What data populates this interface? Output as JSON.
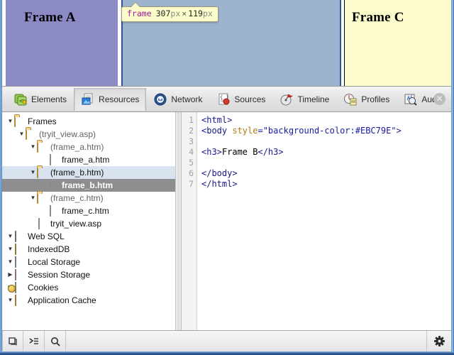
{
  "page": {
    "frames": [
      {
        "name": "frame-a",
        "heading": "Frame A",
        "bg": "#8b8ac4"
      },
      {
        "name": "frame-b",
        "heading": "",
        "bg": "#9db4ce"
      },
      {
        "name": "frame-c",
        "heading": "Frame C",
        "bg": "#fbfbcc"
      }
    ]
  },
  "tooltip": {
    "element": "frame",
    "width": "307",
    "height": "119",
    "unit": "px",
    "separator": "×"
  },
  "devtools": {
    "tabs": [
      {
        "id": "elements",
        "label": "Elements",
        "icon": "elements-icon",
        "selected": false
      },
      {
        "id": "resources",
        "label": "Resources",
        "icon": "resources-icon",
        "selected": true
      },
      {
        "id": "network",
        "label": "Network",
        "icon": "network-icon",
        "selected": false
      },
      {
        "id": "sources",
        "label": "Sources",
        "icon": "sources-icon",
        "selected": false
      },
      {
        "id": "timeline",
        "label": "Timeline",
        "icon": "timeline-icon",
        "selected": false
      },
      {
        "id": "profiles",
        "label": "Profiles",
        "icon": "profiles-icon",
        "selected": false
      },
      {
        "id": "audits",
        "label": "Audits",
        "icon": "audits-icon",
        "selected": false
      }
    ],
    "more_tabs_label": "»",
    "close_label": "✕",
    "statusbar": {
      "dock_icon": "dock-to-side-icon",
      "console_icon": "show-console-icon",
      "search_icon": "search-icon",
      "settings_icon": "gear-icon"
    }
  },
  "resources_tree": [
    {
      "id": "frames",
      "label": "Frames",
      "indent": 0,
      "twisty": "▼",
      "icon": "folder-icon",
      "state": "normal"
    },
    {
      "id": "tryit-view",
      "label": "(tryit_view.asp)",
      "indent": 1,
      "twisty": "▼",
      "icon": "folder-icon",
      "state": "dim"
    },
    {
      "id": "frame-a-dir",
      "label": "(frame_a.htm)",
      "indent": 2,
      "twisty": "▼",
      "icon": "folder-icon",
      "state": "dim"
    },
    {
      "id": "frame-a-file",
      "label": "frame_a.htm",
      "indent": 3,
      "twisty": "",
      "icon": "document-icon",
      "state": "normal"
    },
    {
      "id": "frame-b-dir",
      "label": "(frame_b.htm)",
      "indent": 2,
      "twisty": "▼",
      "icon": "folder-icon",
      "state": "hovered"
    },
    {
      "id": "frame-b-file",
      "label": "frame_b.htm",
      "indent": 3,
      "twisty": "",
      "icon": "document-icon",
      "state": "selected"
    },
    {
      "id": "frame-c-dir",
      "label": "(frame_c.htm)",
      "indent": 2,
      "twisty": "▼",
      "icon": "folder-icon",
      "state": "dim"
    },
    {
      "id": "frame-c-file",
      "label": "frame_c.htm",
      "indent": 3,
      "twisty": "",
      "icon": "document-icon",
      "state": "normal"
    },
    {
      "id": "tryit-file",
      "label": "tryit_view.asp",
      "indent": 2,
      "twisty": "",
      "icon": "document-icon",
      "state": "normal"
    },
    {
      "id": "web-sql",
      "label": "Web SQL",
      "indent": 0,
      "twisty": "▼",
      "icon": "database-icon",
      "state": "normal"
    },
    {
      "id": "indexeddb",
      "label": "IndexedDB",
      "indent": 0,
      "twisty": "▼",
      "icon": "database-yellow-icon",
      "state": "normal"
    },
    {
      "id": "local-storage",
      "label": "Local Storage",
      "indent": 0,
      "twisty": "▼",
      "icon": "grid-blue-icon",
      "state": "normal"
    },
    {
      "id": "session-storage",
      "label": "Session Storage",
      "indent": 0,
      "twisty": "▶",
      "icon": "grid-pink-icon",
      "state": "normal"
    },
    {
      "id": "cookies",
      "label": "Cookies",
      "indent": 0,
      "twisty": "▶",
      "icon": "cookie-icon",
      "state": "normal"
    },
    {
      "id": "app-cache",
      "label": "Application Cache",
      "indent": 0,
      "twisty": "▼",
      "icon": "grid-orange-icon",
      "state": "normal"
    }
  ],
  "source_view": {
    "file": "frame_b.htm",
    "line_numbers": [
      "1",
      "2",
      "3",
      "4",
      "5",
      "6",
      "7"
    ],
    "lines": [
      [
        {
          "t": "tag",
          "s": "<html>"
        }
      ],
      [
        {
          "t": "tag",
          "s": "<body "
        },
        {
          "t": "attr",
          "s": "style"
        },
        {
          "t": "val",
          "s": "=\"background-color:#EBC79E\""
        },
        {
          "t": "tag",
          "s": ">"
        }
      ],
      [],
      [
        {
          "t": "tag",
          "s": "<h3>"
        },
        {
          "t": "txt",
          "s": "Frame B"
        },
        {
          "t": "tag",
          "s": "</h3>"
        }
      ],
      [],
      [
        {
          "t": "tag",
          "s": "</body>"
        }
      ],
      [
        {
          "t": "tag",
          "s": "</html>"
        }
      ]
    ],
    "colors": {
      "tag": "#17178a",
      "attribute": "#b37a11",
      "value": "#1a1aa6",
      "text": "#000000"
    }
  }
}
